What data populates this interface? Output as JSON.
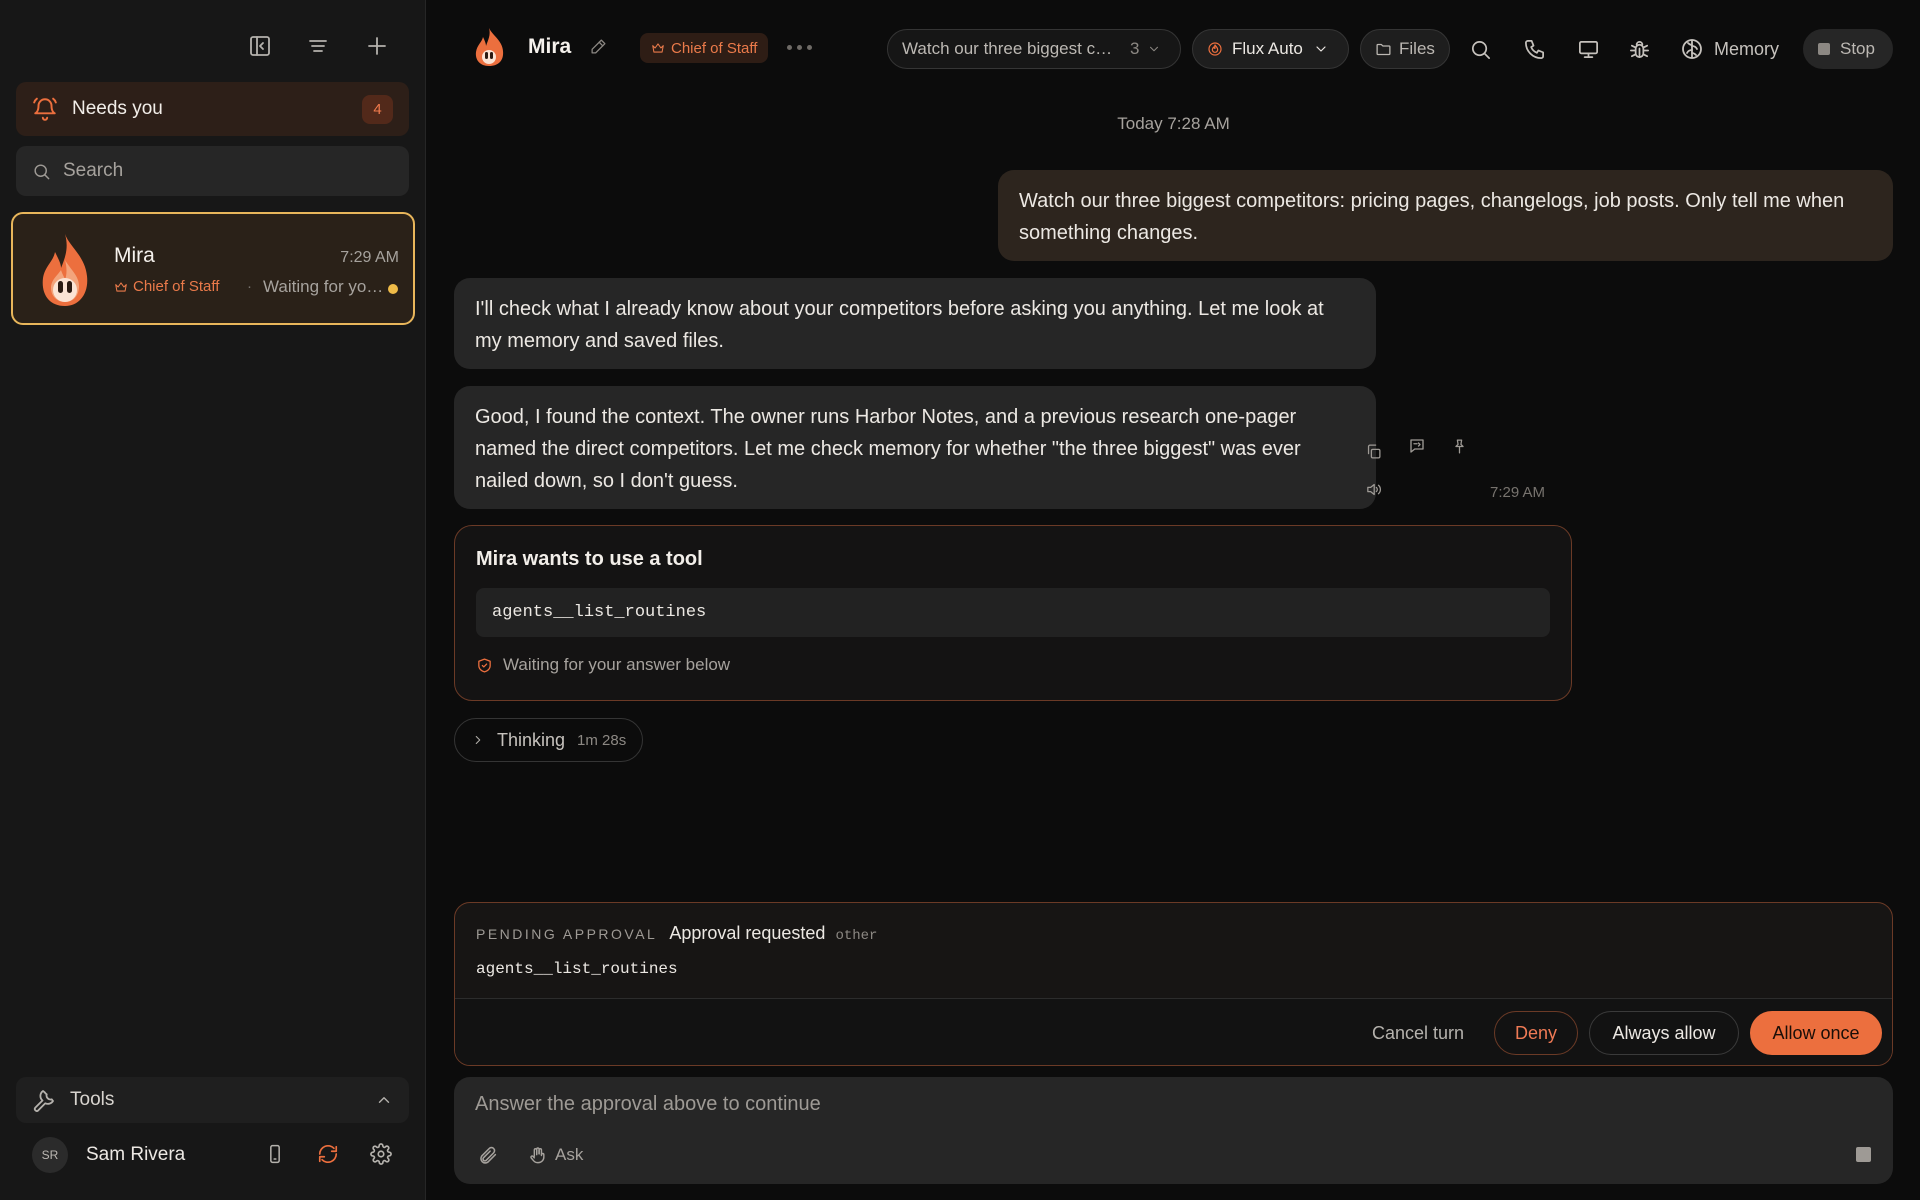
{
  "sidebar": {
    "needs_you": {
      "label": "Needs you",
      "count": "4"
    },
    "search": {
      "placeholder": "Search"
    },
    "conversation": {
      "name": "Mira",
      "time": "7:29 AM",
      "role": "Chief of Staff",
      "separator": "·",
      "preview": "Waiting for your answer",
      "status_color": "#efbb48"
    },
    "tools": {
      "label": "Tools"
    },
    "user": {
      "initials": "SR",
      "name": "Sam Rivera"
    }
  },
  "header": {
    "agent_name": "Mira",
    "role_badge": "Chief of Staff",
    "task_pill": {
      "text": "Watch our three biggest competitors: pricing pages, changelogs, job posts. Only tell me when something changes.",
      "count": "3"
    },
    "model": "Flux Auto",
    "files_label": "Files",
    "memory_label": "Memory",
    "stop_label": "Stop"
  },
  "chat": {
    "date_separator": "Today 7:28 AM",
    "messages": [
      {
        "role": "user",
        "text": "Watch our three biggest competitors: pricing pages, changelogs, job posts. Only tell me when something changes."
      },
      {
        "role": "assistant",
        "text": "I'll check what I already know about your competitors before asking you anything. Let me look at my memory and saved files."
      },
      {
        "role": "assistant",
        "text": "Good, I found the context. The owner runs Harbor Notes, and a previous research one-pager named the direct competitors. Let me check memory for whether \"the three biggest\" was ever nailed down, so I don't guess."
      }
    ],
    "message_time": "7:29 AM",
    "tool_request": {
      "title": "Mira wants to use a tool",
      "tool_name": "agents__list_routines",
      "status": "Waiting for your answer below"
    },
    "thinking": {
      "label": "Thinking",
      "duration": "1m 28s"
    }
  },
  "approval": {
    "eyebrow": "PENDING APPROVAL",
    "title": "Approval requested",
    "kind": "other",
    "tool_name": "agents__list_routines",
    "buttons": {
      "cancel": "Cancel turn",
      "deny": "Deny",
      "always": "Always allow",
      "once": "Allow once"
    }
  },
  "composer": {
    "placeholder": "Answer the approval above to continue",
    "ask_label": "Ask"
  },
  "colors": {
    "accent": "#ec6f3e",
    "highlight_border": "#e8b65b",
    "background": "#0c0c0c",
    "sidebar": "#171717"
  }
}
